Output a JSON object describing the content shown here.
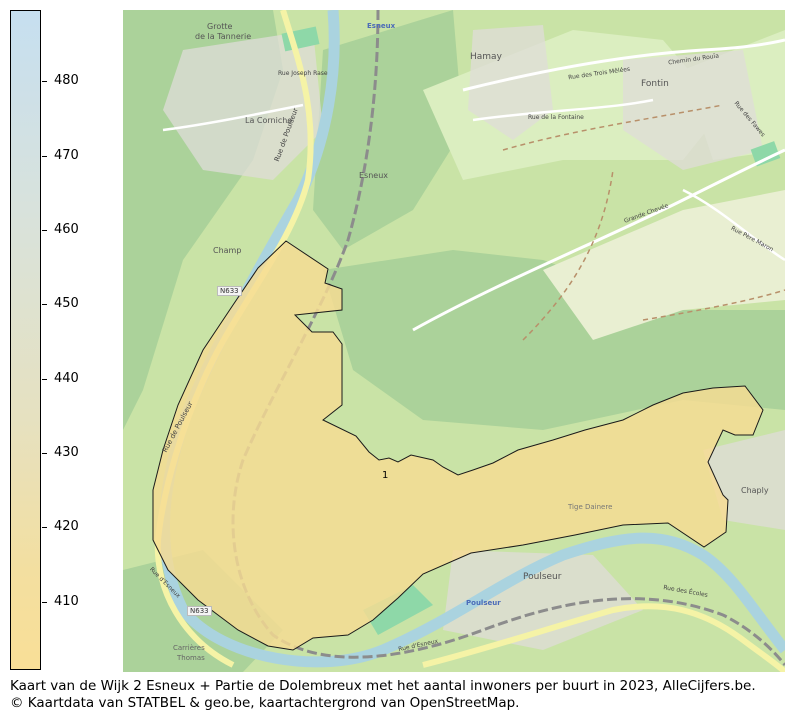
{
  "colorbar": {
    "ticks": [
      "480",
      "470",
      "460",
      "450",
      "440",
      "430",
      "420",
      "410"
    ],
    "min": 401,
    "max": 490
  },
  "map": {
    "region_label": "1",
    "region_value": 405,
    "fill_color": "#f6dc93",
    "places": {
      "esneux_station": "Esneux",
      "esneux": "Esneux",
      "hamay": "Hamay",
      "fontin": "Fontin",
      "la_corniche": "La Corniche",
      "grotte": "Grotte",
      "de_la_tannerie": "de la Tannerie",
      "champ": "Champ",
      "poulseur": "Poulseur",
      "poulseur_station": "Poulseur",
      "chaply": "Chaply",
      "tige": "Tige Dainere",
      "carrieres": "Carrières",
      "thomas": "Thomas"
    },
    "roads": {
      "n633_a": "N633",
      "n633_b": "N633",
      "rue_poulseur_a": "Rue de Poulseur",
      "rue_poulseur_b": "Rue de Poulseur",
      "rue_esneux_a": "Rue d'Esneux",
      "rue_esneux_b": "Rue d'Esneux",
      "rue_joseph": "Rue Joseph Rase",
      "rue_ecoles": "Rue des Écoles",
      "rue_fontaine": "Rue de la Fontaine",
      "grande_chevee": "Grande Chevée",
      "rue_pere_maron": "Rue Père Maron",
      "rue_trois_melees": "Rue des Trois Mêlées",
      "chemin_rouia": "Chemin du Rouïa",
      "rue_fawes": "Rue des Fawes"
    }
  },
  "caption": {
    "line1": "Kaart van de Wijk 2 Esneux + Partie de Dolembreux met het aantal inwoners per buurt in 2023, AlleCijfers.be.",
    "line2": "© Kaartdata van STATBEL & geo.be, kaartachtergrond van OpenStreetMap."
  }
}
